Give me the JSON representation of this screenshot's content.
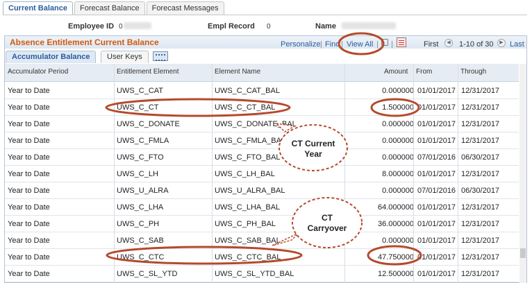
{
  "tabs": [
    {
      "label": "Current Balance",
      "active": true
    },
    {
      "label": "Forecast Balance",
      "active": false
    },
    {
      "label": "Forecast Messages",
      "active": false
    }
  ],
  "header": {
    "employee_id_label": "Employee ID",
    "employee_id_value": "0",
    "empl_record_label": "Empl Record",
    "empl_record_value": "0",
    "name_label": "Name"
  },
  "grid": {
    "title": "Absence Entitlement Current Balance",
    "personalize": "Personalize",
    "find": "Find",
    "view_all": "View All",
    "first": "First",
    "range": "1-10 of 30",
    "last": "Last",
    "sub_tabs": [
      {
        "label": "Accumulator Balance",
        "active": true
      },
      {
        "label": "User Keys",
        "active": false
      }
    ],
    "columns": [
      "Accumulator Period",
      "Entitlement Element",
      "Element Name",
      "Amount",
      "From",
      "Through"
    ],
    "rows": [
      {
        "period": "Year to Date",
        "entitlement": "UWS_C_CAT",
        "element": "UWS_C_CAT_BAL",
        "amount": "0.000000",
        "from": "01/01/2017",
        "through": "12/31/2017"
      },
      {
        "period": "Year to Date",
        "entitlement": "UWS_C_CT",
        "element": "UWS_C_CT_BAL",
        "amount": "1.500000",
        "from": "01/01/2017",
        "through": "12/31/2017"
      },
      {
        "period": "Year to Date",
        "entitlement": "UWS_C_DONATE",
        "element": "UWS_C_DONATE_BAL",
        "amount": "0.000000",
        "from": "01/01/2017",
        "through": "12/31/2017"
      },
      {
        "period": "Year to Date",
        "entitlement": "UWS_C_FMLA",
        "element": "UWS_C_FMLA_BAL",
        "amount": "0.000000",
        "from": "01/01/2017",
        "through": "12/31/2017"
      },
      {
        "period": "Year to Date",
        "entitlement": "UWS_C_FTO",
        "element": "UWS_C_FTO_BAL",
        "amount": "0.000000",
        "from": "07/01/2016",
        "through": "06/30/2017"
      },
      {
        "period": "Year to Date",
        "entitlement": "UWS_C_LH",
        "element": "UWS_C_LH_BAL",
        "amount": "8.000000",
        "from": "01/01/2017",
        "through": "12/31/2017"
      },
      {
        "period": "Year to Date",
        "entitlement": "UWS_U_ALRA",
        "element": "UWS_U_ALRA_BAL",
        "amount": "0.000000",
        "from": "07/01/2016",
        "through": "06/30/2017"
      },
      {
        "period": "Year to Date",
        "entitlement": "UWS_C_LHA",
        "element": "UWS_C_LHA_BAL",
        "amount": "64.000000",
        "from": "01/01/2017",
        "through": "12/31/2017"
      },
      {
        "period": "Year to Date",
        "entitlement": "UWS_C_PH",
        "element": "UWS_C_PH_BAL",
        "amount": "36.000000",
        "from": "01/01/2017",
        "through": "12/31/2017"
      },
      {
        "period": "Year to Date",
        "entitlement": "UWS_C_SAB",
        "element": "UWS_C_SAB_BAL",
        "amount": "0.000000",
        "from": "01/01/2017",
        "through": "12/31/2017"
      },
      {
        "period": "Year to Date",
        "entitlement": "UWS_C_CTC",
        "element": "UWS_C_CTC_BAL",
        "amount": "47.750000",
        "from": "01/01/2017",
        "through": "12/31/2017"
      },
      {
        "period": "Year to Date",
        "entitlement": "UWS_C_SL_YTD",
        "element": "UWS_C_SL_YTD_BAL",
        "amount": "12.500000",
        "from": "01/01/2017",
        "through": "12/31/2017"
      }
    ]
  },
  "annotations": {
    "ct_current_year": "CT Current Year",
    "ct_current_year_line1": "CT Current",
    "ct_current_year_line2": "Year",
    "ct_carryover": "CT Carryover",
    "ct_carryover_line1": "CT",
    "ct_carryover_line2": "Carryover",
    "highlight_color": "#b5492c"
  },
  "colors": {
    "title_orange": "#d35a0d",
    "link_blue": "#2a5d9b",
    "header_bg": "#e6ecf3"
  }
}
